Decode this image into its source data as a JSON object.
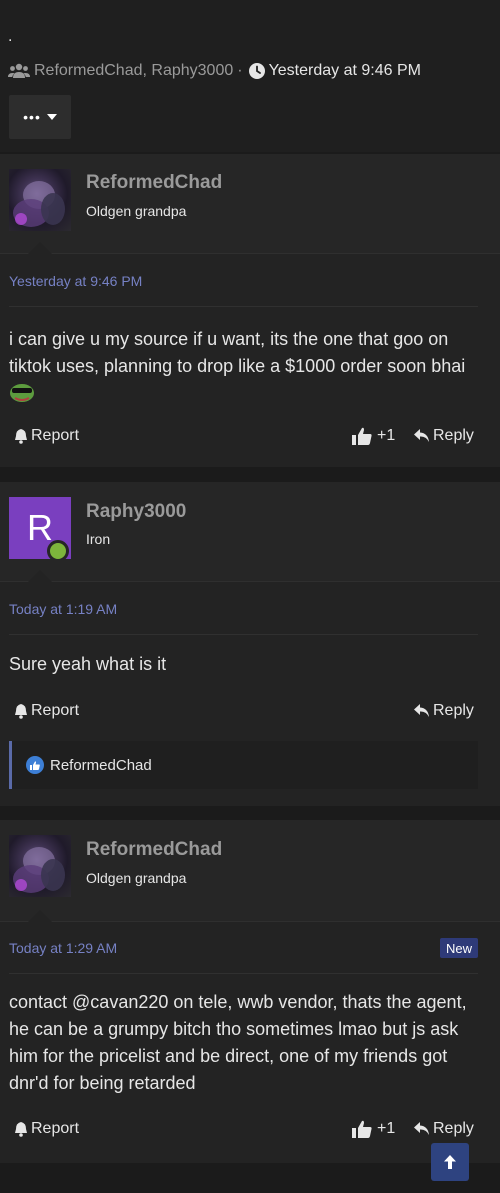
{
  "thread": {
    "title": ".",
    "participants": [
      "ReformedChad",
      "Raphy3000"
    ],
    "separator": "·",
    "time": "Yesterday at 9:46 PM"
  },
  "posts": [
    {
      "username": "ReformedChad",
      "user_title": "Oldgen grandpa",
      "date": "Yesterday at 9:46 PM",
      "body": "i can give u my source if u want, its the one that goo on tiktok uses, planning to drop like a $1000 order soon bhai",
      "report_label": "Report",
      "like_count": "+1",
      "reply_label": "Reply"
    },
    {
      "username": "Raphy3000",
      "avatar_letter": "R",
      "user_title": "Iron",
      "date": "Today at 1:19 AM",
      "body": "Sure yeah what is it",
      "report_label": "Report",
      "reply_label": "Reply",
      "liked_by": "ReformedChad"
    },
    {
      "username": "ReformedChad",
      "user_title": "Oldgen grandpa",
      "date": "Today at 1:29 AM",
      "badge": "New",
      "body": "contact @cavan220 on tele, wwb vendor, thats the agent, he can be a grumpy bitch tho sometimes lmao but js ask him for the pricelist and be direct, one of my friends got dnr'd for being retarded",
      "report_label": "Report",
      "like_count": "+1",
      "reply_label": "Reply"
    }
  ],
  "icons": {
    "users": "users-icon",
    "clock": "clock-icon",
    "bell": "bell-icon",
    "thumbs_up": "thumbs-up-icon",
    "reply": "reply-arrow-icon",
    "scroll_top": "arrow-up-icon",
    "emoji": "pepe-emoji-icon"
  },
  "colors": {
    "background": "#1b1b1b",
    "post_bg": "#232323",
    "date_link": "#7681c4",
    "badge": "#2e3a78",
    "avatar_letter_bg": "#7a3fbf",
    "online": "#7db53c"
  }
}
